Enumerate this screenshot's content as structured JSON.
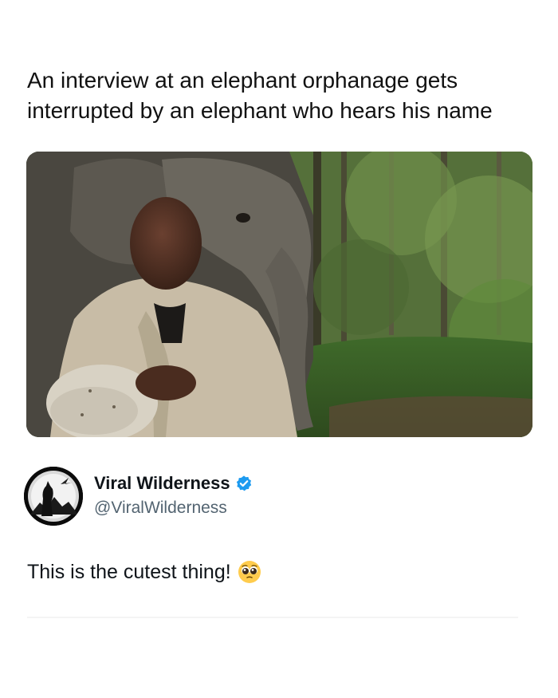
{
  "post": {
    "caption": "An interview at an elephant orphanage gets interrupted by an elephant who hears his name",
    "media": {
      "description_icon": "photo-elephant-and-man"
    }
  },
  "tweet": {
    "author_name": "Viral Wilderness",
    "author_handle": "@ViralWilderness",
    "verified": true,
    "text": "This is the cutest thing!",
    "emoji": "pleading-face-emoji",
    "colors": {
      "name": "#0f1419",
      "handle": "#536471",
      "verified_badge": "#1d9bf0"
    }
  }
}
